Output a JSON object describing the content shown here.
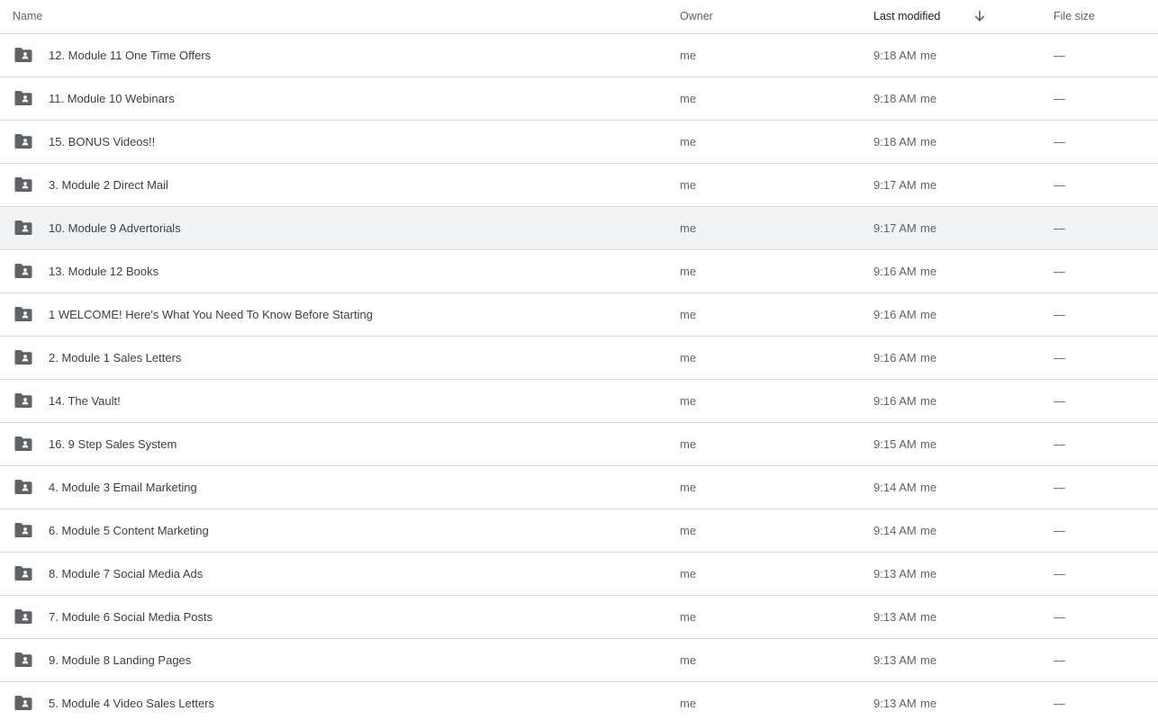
{
  "headers": {
    "name": "Name",
    "owner": "Owner",
    "last_modified": "Last modified",
    "file_size": "File size",
    "sort_icon": "arrow-down-icon"
  },
  "folder_icon": "shared-folder-icon",
  "hovered_row_index": 4,
  "rows": [
    {
      "name": "12. Module 11 One Time Offers",
      "owner": "me",
      "time": "9:18 AM",
      "by": "me",
      "size": "—"
    },
    {
      "name": "11. Module 10 Webinars",
      "owner": "me",
      "time": "9:18 AM",
      "by": "me",
      "size": "—"
    },
    {
      "name": "15. BONUS Videos!!",
      "owner": "me",
      "time": "9:18 AM",
      "by": "me",
      "size": "—"
    },
    {
      "name": "3. Module 2 Direct Mail",
      "owner": "me",
      "time": "9:17 AM",
      "by": "me",
      "size": "—"
    },
    {
      "name": "10. Module 9 Advertorials",
      "owner": "me",
      "time": "9:17 AM",
      "by": "me",
      "size": "—"
    },
    {
      "name": "13. Module 12 Books",
      "owner": "me",
      "time": "9:16 AM",
      "by": "me",
      "size": "—"
    },
    {
      "name": "1 WELCOME! Here's What You Need To Know Before Starting",
      "owner": "me",
      "time": "9:16 AM",
      "by": "me",
      "size": "—"
    },
    {
      "name": "2. Module 1 Sales Letters",
      "owner": "me",
      "time": "9:16 AM",
      "by": "me",
      "size": "—"
    },
    {
      "name": "14. The Vault!",
      "owner": "me",
      "time": "9:16 AM",
      "by": "me",
      "size": "—"
    },
    {
      "name": "16. 9 Step Sales System",
      "owner": "me",
      "time": "9:15 AM",
      "by": "me",
      "size": "—"
    },
    {
      "name": "4. Module 3 Email Marketing",
      "owner": "me",
      "time": "9:14 AM",
      "by": "me",
      "size": "—"
    },
    {
      "name": "6. Module 5 Content Marketing",
      "owner": "me",
      "time": "9:14 AM",
      "by": "me",
      "size": "—"
    },
    {
      "name": "8. Module 7 Social Media Ads",
      "owner": "me",
      "time": "9:13 AM",
      "by": "me",
      "size": "—"
    },
    {
      "name": "7. Module 6 Social Media Posts",
      "owner": "me",
      "time": "9:13 AM",
      "by": "me",
      "size": "—"
    },
    {
      "name": "9. Module 8 Landing Pages",
      "owner": "me",
      "time": "9:13 AM",
      "by": "me",
      "size": "—"
    },
    {
      "name": "5. Module 4 Video Sales Letters",
      "owner": "me",
      "time": "9:13 AM",
      "by": "me",
      "size": "—"
    }
  ]
}
